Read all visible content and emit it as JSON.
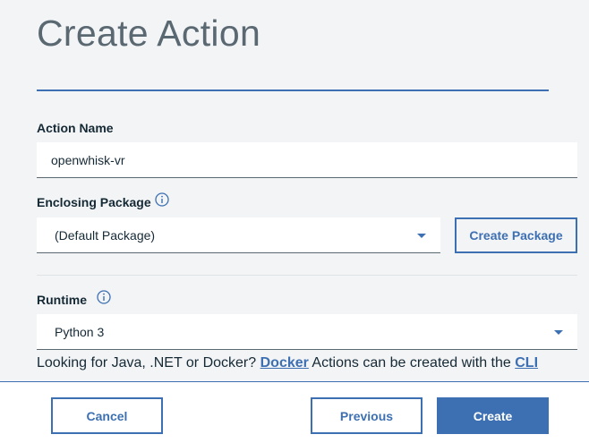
{
  "page": {
    "title": "Create Action"
  },
  "form": {
    "action_name": {
      "label": "Action Name",
      "value": "openwhisk-vr"
    },
    "enclosing_package": {
      "label": "Enclosing Package",
      "selected": "(Default Package)",
      "create_label": "Create Package"
    },
    "runtime": {
      "label": "Runtime",
      "selected": "Python 3"
    },
    "hint": {
      "prefix": "Looking for Java, .NET or Docker?",
      "docker_link": "Docker",
      "middle": "Actions can be created with the",
      "cli_link": "CLI"
    }
  },
  "footer": {
    "cancel": "Cancel",
    "previous": "Previous",
    "create": "Create"
  },
  "icons": {
    "info": "info-icon",
    "dropdown": "chevron-down-icon"
  },
  "colors": {
    "accent": "#3d70b2",
    "background": "#f3f4f6",
    "text": "#152935"
  }
}
